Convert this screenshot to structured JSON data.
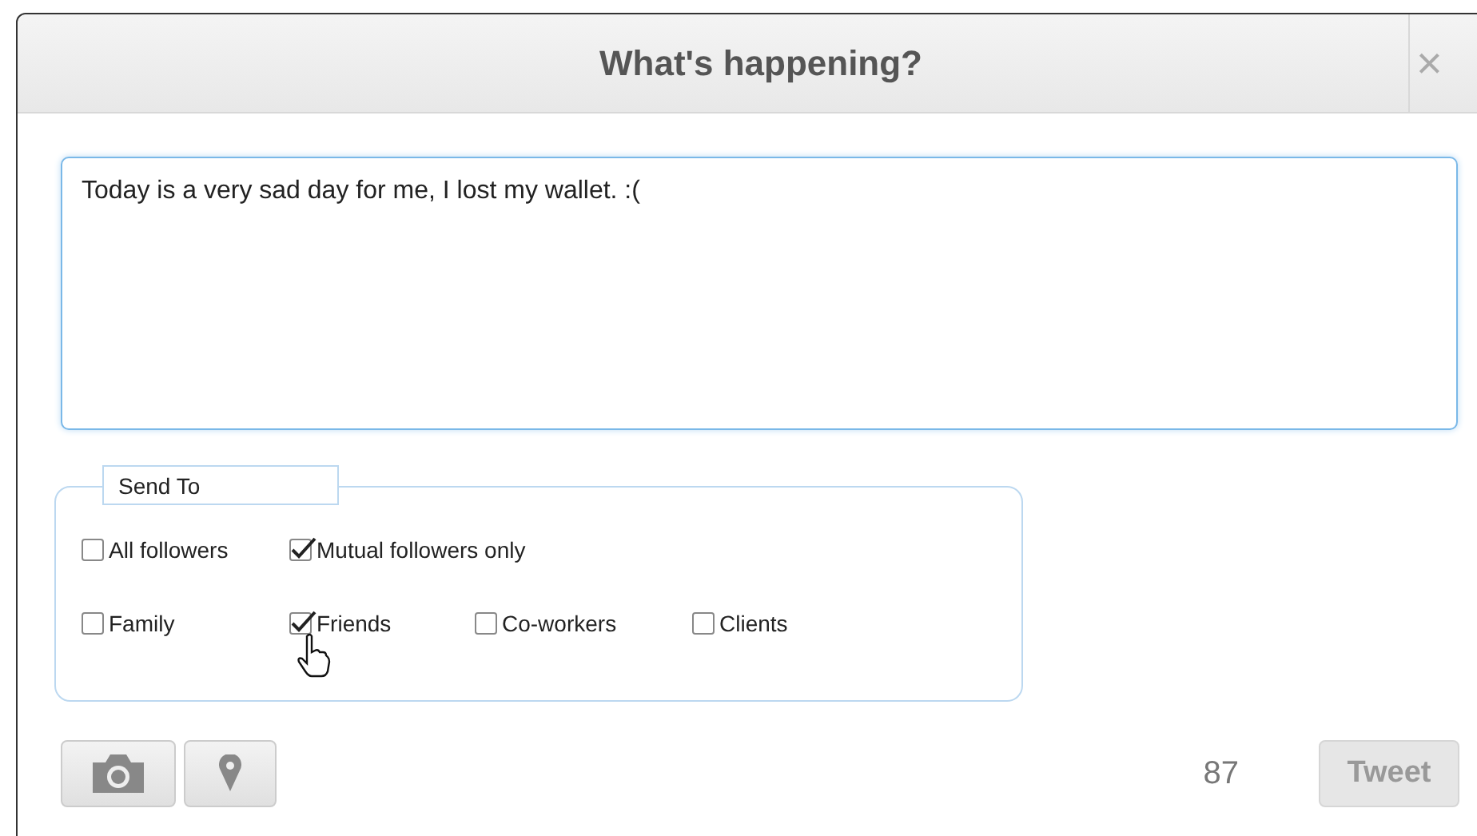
{
  "dialog": {
    "title": "What's happening?",
    "close": "×"
  },
  "message": {
    "value": "Today is a very sad day for me, I lost my wallet. :("
  },
  "send_to": {
    "legend": "Send To",
    "rows": [
      [
        {
          "label": "All followers",
          "checked": false
        },
        {
          "label": "Mutual followers only",
          "checked": true
        }
      ],
      [
        {
          "label": "Family",
          "checked": false
        },
        {
          "label": "Friends",
          "checked": true,
          "hovered": true
        },
        {
          "label": "Co-workers",
          "checked": false
        },
        {
          "label": "Clients",
          "checked": false
        }
      ]
    ]
  },
  "footer": {
    "counter": "87",
    "tweet": {
      "label": "Tweet",
      "disabled": true
    }
  }
}
